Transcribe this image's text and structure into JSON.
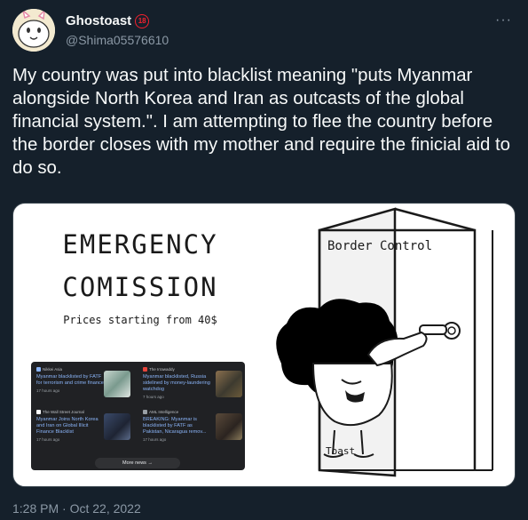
{
  "tweet": {
    "display_name": "Ghostoast",
    "age_badge": "18",
    "handle": "@Shima05576610",
    "text": "My country was put into blacklist meaning \"puts Myanmar alongside North Korea and Iran as outcasts of the global financial system.\". I am attempting to flee the country before the border closes with my mother and require the finicial aid to do so.",
    "timestamp": "1:28 PM · Oct 22, 2022",
    "more_icon": "ellipsis-icon"
  },
  "image": {
    "title_line1": "EMERGENCY",
    "title_line2": "COMISSION",
    "prices": "Prices starting from 40$",
    "door_sign": "Border Control",
    "character_label": "Toast",
    "news": [
      {
        "source": "Nikkei Asia",
        "headline": "Myanmar blacklisted by FATF for terrorism and crime finance",
        "ago": "17 hours ago"
      },
      {
        "source": "The Irrawaddy",
        "headline": "Myanmar blacklisted, Russia sidelined by money-laundering watchdog",
        "ago": "7 hours ago"
      },
      {
        "source": "The Wall Street Journal",
        "headline": "Myanmar Joins North Korea and Iran on Global Illicit Finance Blacklist",
        "ago": "17 hours ago"
      },
      {
        "source": "AML Intelligence",
        "headline": "BREAKING: Myanmar is blacklisted by FATF as Pakistan, Nicaragua remov...",
        "ago": "17 hours ago"
      }
    ],
    "more_news": "More news →"
  },
  "colors": {
    "background": "#15202b",
    "text": "#f7f9f9",
    "secondary": "#8b98a5",
    "age_badge": "#f4212e",
    "news_link": "#8ab4f8"
  }
}
